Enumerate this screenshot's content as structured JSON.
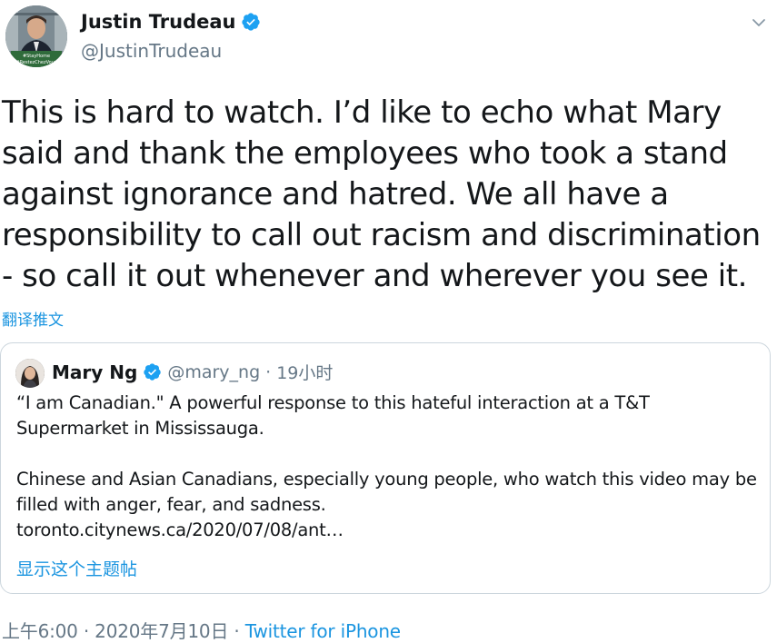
{
  "tweet": {
    "author": {
      "name": "Justin Trudeau",
      "handle": "@JustinTrudeau",
      "avatar_caption_1": "#StayHome",
      "avatar_caption_2": "#RestezChezVous",
      "verified": true
    },
    "text": "This is hard to watch. I’d like to echo what Mary said and thank the employees who took a stand against ignorance and hatred. We all have a responsibility to call out racism and discrimination - so call it out whenever and wherever you see it.",
    "translate_label": "翻译推文",
    "menu_icon": "chevron-down-icon"
  },
  "quote": {
    "author": {
      "name": "Mary Ng",
      "handle": "@mary_ng",
      "verified": true
    },
    "separator": "·",
    "time": "19小时",
    "paragraph1": "“I am Canadian.\" A powerful response to this hateful interaction at a T&T Supermarket in Mississauga.",
    "paragraph2": "Chinese and Asian Canadians, especially young people, who watch this video may be filled with anger, fear, and sadness.",
    "link": "toronto.citynews.ca/2020/07/08/ant…",
    "show_thread_label": "显示这个主题帖"
  },
  "footer": {
    "timestamp": "上午6:00 · 2020年7月10日",
    "separator": " · ",
    "source": "Twitter for iPhone"
  },
  "colors": {
    "accent": "#1b95e0",
    "verified": "#1da1f2",
    "secondary_text": "#657786",
    "border": "#ccd6dd"
  }
}
